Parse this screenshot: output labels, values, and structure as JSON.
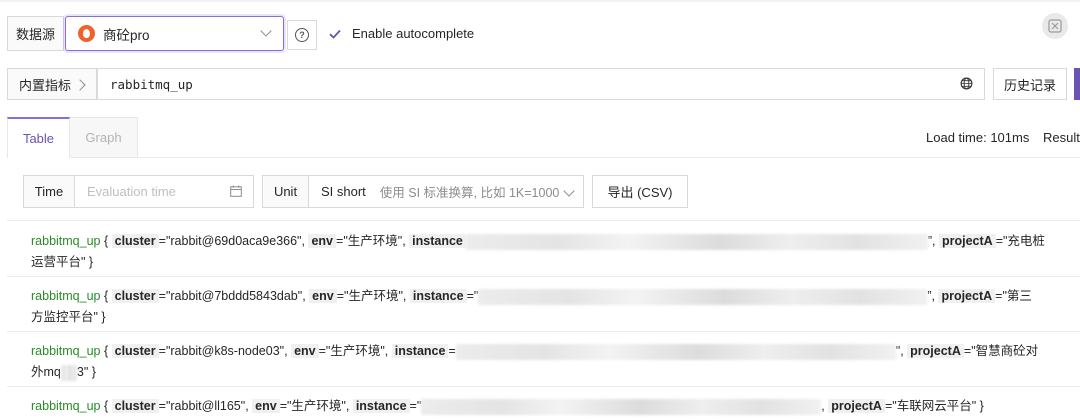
{
  "toolbar": {
    "datasource_label": "数据源",
    "datasource_value": "商砼pro",
    "autocomplete_label": "Enable autocomplete",
    "autocomplete_checked": true
  },
  "query": {
    "builtin_metrics_label": "内置指标",
    "expression": "rabbitmq_up",
    "history_button": "历史记录"
  },
  "tabs": [
    {
      "label": "Table",
      "active": true
    },
    {
      "label": "Graph",
      "active": false
    }
  ],
  "status": {
    "load_time": "Load time: 101ms",
    "result_label": "Result"
  },
  "filters": {
    "time_label": "Time",
    "time_placeholder": "Evaluation time",
    "unit_label": "Unit",
    "unit_value": "SI short",
    "unit_hint": "使用 SI 标准换算, 比如 1K=1000",
    "export_button": "导出 (CSV)"
  },
  "results": [
    {
      "metric": "rabbitmq_up",
      "cluster": "\"rabbit@69d0aca9e366\"",
      "env": "\"生产环境\"",
      "instance_tail": "”",
      "projectA_1": "\"充电桩",
      "projectA_2": "运营平台\" }"
    },
    {
      "metric": "rabbitmq_up",
      "cluster": "\"rabbit@7bddd5843dab\"",
      "env": "\"生产环境\"",
      "instance_head": "\"",
      "instance_tail": "”",
      "projectA_1": "\"第三",
      "projectA_2": "方监控平台\" }"
    },
    {
      "metric": "rabbitmq_up",
      "cluster": "\"rabbit@k8s-node03\"",
      "env": "\"生产环境\"",
      "instance_tail": "\"",
      "projectA_1": "\"智慧商砼对",
      "projectA_2a": "外mq",
      "projectA_2b": "3\" }"
    },
    {
      "metric": "rabbitmq_up",
      "cluster": "\"rabbit@ll165\"",
      "env": "\"生产环境\"",
      "instance_head": "\"",
      "projectA_1": "\"车联网云平台\" }"
    }
  ],
  "labels": {
    "cluster": "cluster",
    "env": "env",
    "instance": "instance",
    "projectA": "projectA"
  },
  "colors": {
    "accent": "#8a6bdc",
    "metric_green": "#2a8a2a",
    "brand_orange": "#f0612c"
  }
}
